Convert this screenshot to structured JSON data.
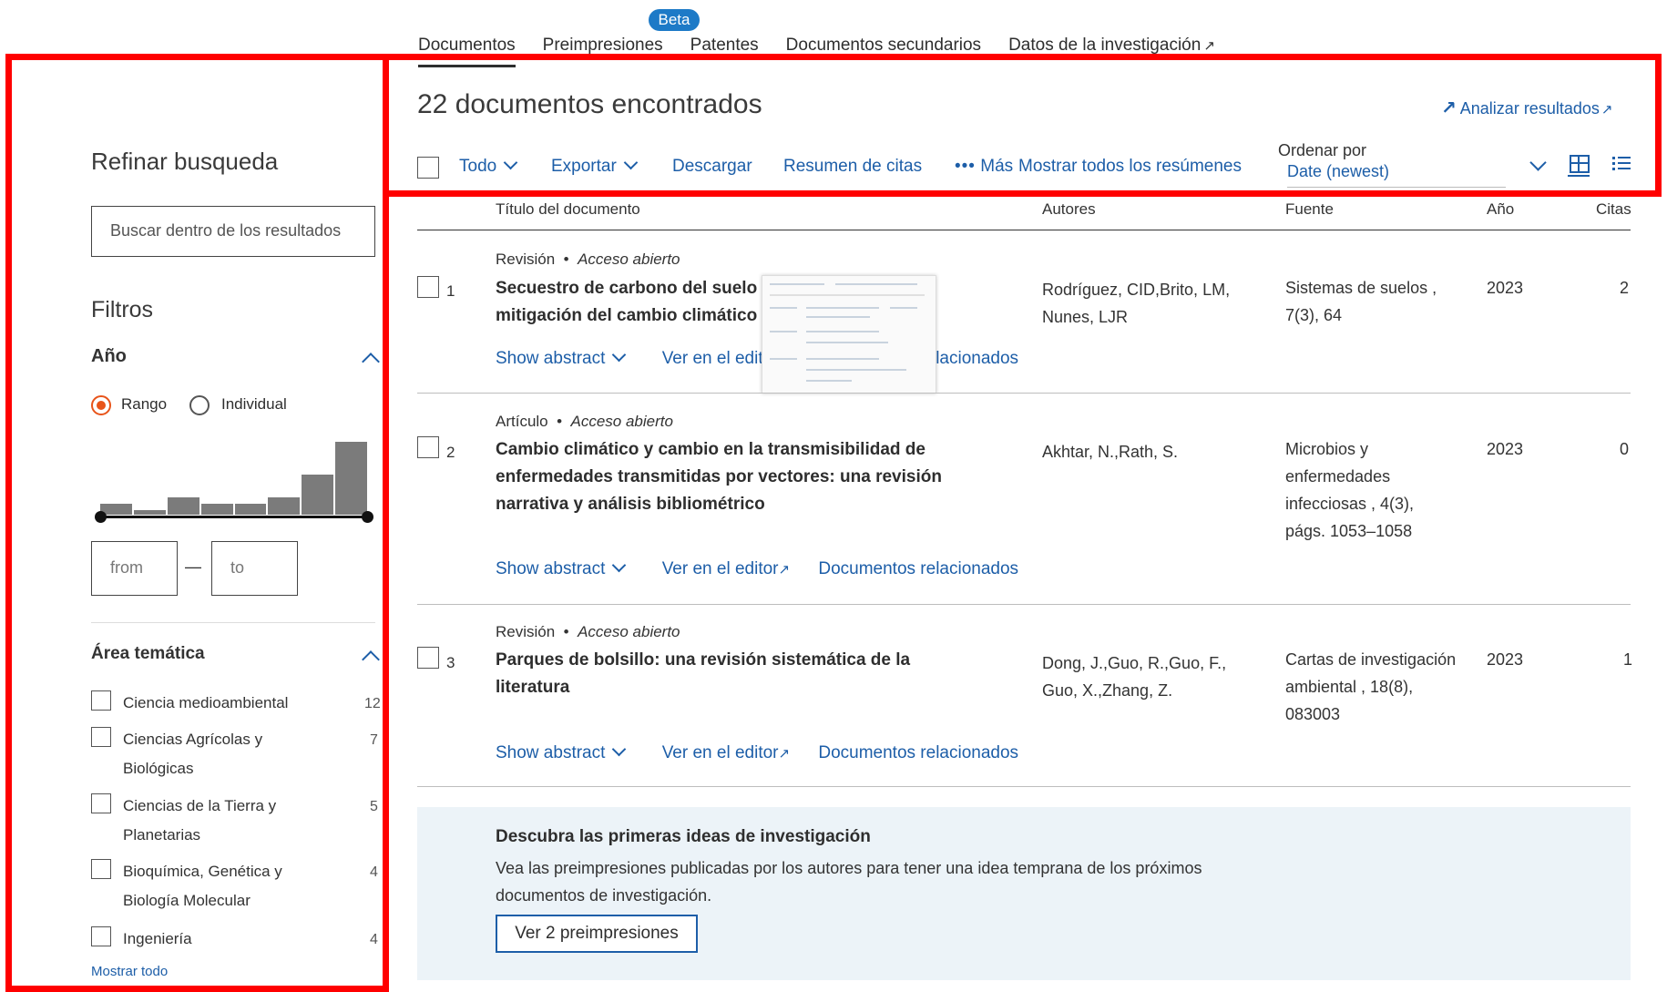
{
  "tabs": {
    "documents": "Documentos",
    "preprints": "Preimpresiones",
    "patents": "Patentes",
    "secondary": "Documentos secundarios",
    "research_data": "Datos de la investigación",
    "beta_badge": "Beta"
  },
  "sidebar": {
    "title": "Refinar busqueda",
    "search_placeholder": "Buscar dentro de los resultados",
    "filters_title": "Filtros",
    "year": {
      "heading": "Año",
      "radio_range": "Rango",
      "radio_individual": "Individual",
      "histogram": [
        0.15,
        0.06,
        0.24,
        0.15,
        0.15,
        0.24,
        0.55,
        1.0
      ],
      "from_placeholder": "from",
      "to_placeholder": "to",
      "dash": "—"
    },
    "subject": {
      "heading": "Área temática",
      "items": [
        {
          "label1": "Ciencia medioambiental",
          "label2": "",
          "count": "12"
        },
        {
          "label1": "Ciencias Agrícolas y",
          "label2": "Biológicas",
          "count": "7"
        },
        {
          "label1": "Ciencias de la Tierra y",
          "label2": "Planetarias",
          "count": "5"
        },
        {
          "label1": "Bioquímica, Genética y",
          "label2": "Biología Molecular",
          "count": "4"
        },
        {
          "label1": "Ingeniería",
          "label2": "",
          "count": "4"
        }
      ],
      "show_all": "Mostrar todo"
    }
  },
  "results": {
    "count_title": "22 documentos encontrados",
    "analyze": "Analizar resultados",
    "toolbar": {
      "all": "Todo",
      "export": "Exportar",
      "download": "Descargar",
      "citation_summary": "Resumen de citas",
      "more": "Más",
      "show_abstracts": "Mostrar todos los resúmenes",
      "sort_label": "Ordenar por",
      "sort_value": "Date (newest)"
    },
    "columns": {
      "title": "Título del documento",
      "authors": "Autores",
      "source": "Fuente",
      "year": "Año",
      "citations": "Citas"
    },
    "docs": [
      {
        "num": "1",
        "type": "Revisión",
        "access": "Acceso abierto",
        "title_line1": "Secuestro de carbono del suelo",
        "title_line2": "mitigación del cambio climático",
        "title_line3": "",
        "authors_line1": "Rodríguez, CID,Brito, LM,",
        "authors_line2": "Nunes, LJR",
        "source_line1": "Sistemas de suelos ,",
        "source_line2": "7(3), 64",
        "source_line3": "",
        "source_line4": "",
        "year": "2023",
        "citations": "2",
        "show_abstract": "Show abstract",
        "view_publisher": "Ver en el editor",
        "related": "Documentos relacionados"
      },
      {
        "num": "2",
        "type": "Artículo",
        "access": "Acceso abierto",
        "title_line1": "Cambio climático y cambio en la transmisibilidad de",
        "title_line2": "enfermedades transmitidas por vectores: una revisión",
        "title_line3": "narrativa y análisis bibliométrico",
        "authors_line1": "Akhtar, N.,Rath, S.",
        "authors_line2": "",
        "source_line1": "Microbios y",
        "source_line2": "enfermedades",
        "source_line3": "infecciosas , 4(3),",
        "source_line4": "págs. 1053–1058",
        "year": "2023",
        "citations": "0",
        "show_abstract": "Show abstract",
        "view_publisher": "Ver en el editor",
        "related": "Documentos relacionados"
      },
      {
        "num": "3",
        "type": "Revisión",
        "access": "Acceso abierto",
        "title_line1": "Parques de bolsillo: una revisión sistemática de la",
        "title_line2": "literatura",
        "title_line3": "",
        "authors_line1": "Dong, J.,Guo, R.,Guo, F.,",
        "authors_line2": "Guo, X.,Zhang, Z.",
        "source_line1": "Cartas de investigación",
        "source_line2": "ambiental , 18(8),",
        "source_line3": "083003",
        "source_line4": "",
        "year": "2023",
        "citations": "1",
        "show_abstract": "Show abstract",
        "view_publisher": "Ver en el editor",
        "related": "Documentos relacionados"
      }
    ],
    "promo": {
      "heading": "Descubra las primeras ideas de investigación",
      "text": "Vea las preimpresiones publicadas por los autores para tener una idea temprana de los próximos documentos de investigación.",
      "button": "Ver 2 preimpresiones"
    }
  },
  "colors": {
    "link": "#1d5ea8",
    "highlight_box": "#ff0000",
    "radio_selected": "#e8541a",
    "promo_bg": "#ecf3f8"
  }
}
